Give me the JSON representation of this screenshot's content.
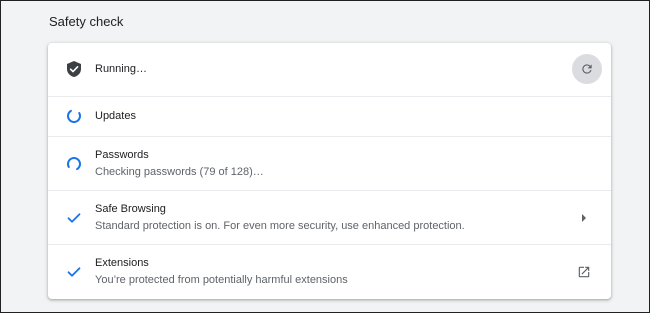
{
  "section": {
    "title": "Safety check"
  },
  "status": {
    "label": "Running…",
    "icon": "shield-check-icon",
    "action_icon": "refresh-icon"
  },
  "items": [
    {
      "id": "updates",
      "title": "Updates",
      "subtitle": "",
      "state_icon": "spinner-icon"
    },
    {
      "id": "passwords",
      "title": "Passwords",
      "subtitle": "Checking passwords (79 of 128)…",
      "state_icon": "spinner-icon"
    },
    {
      "id": "safe-browsing",
      "title": "Safe Browsing",
      "subtitle": "Standard protection is on. For even more security, use enhanced protection.",
      "state_icon": "checkmark-icon",
      "action_icon": "arrow-right-icon"
    },
    {
      "id": "extensions",
      "title": "Extensions",
      "subtitle": "You’re protected from potentially harmful extensions",
      "state_icon": "checkmark-icon",
      "action_icon": "open-in-new-icon"
    }
  ],
  "colors": {
    "accent": "#1a73e8",
    "icon_dark": "#5f6368",
    "shield": "#3c4043"
  }
}
